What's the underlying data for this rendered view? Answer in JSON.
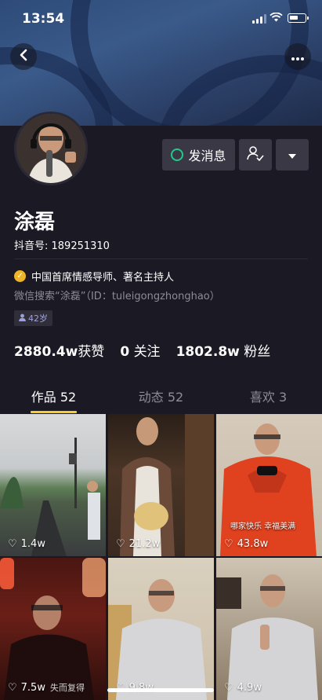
{
  "status_bar": {
    "time": "13:54"
  },
  "profile": {
    "name": "涂磊",
    "douyin_id": "抖音号: 189251310",
    "verification": "中国首席情感导师、著名主持人",
    "wechat": "微信搜索“涂磊”（ID：tuleigongzhonghao）",
    "age": "42岁"
  },
  "actions": {
    "message_label": "发消息"
  },
  "stats": {
    "likes_value": "2880.4w",
    "likes_label": "获赞",
    "following_value": "0",
    "following_label": "关注",
    "followers_value": "1802.8w",
    "followers_label": "粉丝"
  },
  "tabs": [
    {
      "label": "作品 52"
    },
    {
      "label": "动态 52"
    },
    {
      "label": "喜欢 3"
    }
  ],
  "videos": [
    {
      "likes": "1.4w"
    },
    {
      "likes": "21.2w"
    },
    {
      "likes": "43.8w"
    },
    {
      "likes": "7.5w",
      "caption": "失而复得"
    },
    {
      "likes": "9.8w"
    },
    {
      "likes": "4.9w"
    }
  ],
  "overlay_text": {
    "video3": "哪家快乐  幸福美满"
  },
  "colors": {
    "accent": "#f5cd2d",
    "verify": "#f0b429",
    "message_dot": "#22c98a"
  }
}
